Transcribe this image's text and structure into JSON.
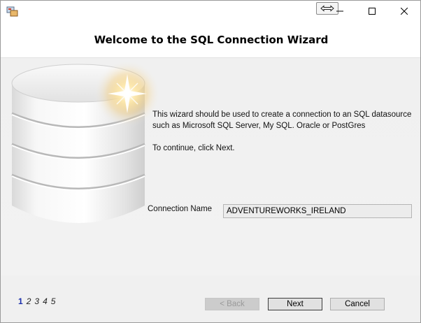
{
  "window": {
    "snap_icon": "double-arrow-icon",
    "caption_buttons": [
      "minimize-icon",
      "maximize-icon",
      "close-icon"
    ]
  },
  "header": {
    "title": "Welcome to the SQL Connection Wizard"
  },
  "intro": {
    "line1": "This wizard should be used to create a connection to an SQL datasource such as Microsoft SQL Server, My SQL. Oracle or PostGres",
    "line2": "To continue, click Next."
  },
  "connection": {
    "label": "Connection Name",
    "value": "ADVENTUREWORKS_IRELAND"
  },
  "steps": {
    "items": [
      "1",
      "2",
      "3",
      "4",
      "5"
    ],
    "current": "1"
  },
  "buttons": {
    "back": "< Back",
    "next": "Next",
    "cancel": "Cancel"
  },
  "colors": {
    "step_current": "#1a2dab",
    "background": "#f0f0f0"
  }
}
